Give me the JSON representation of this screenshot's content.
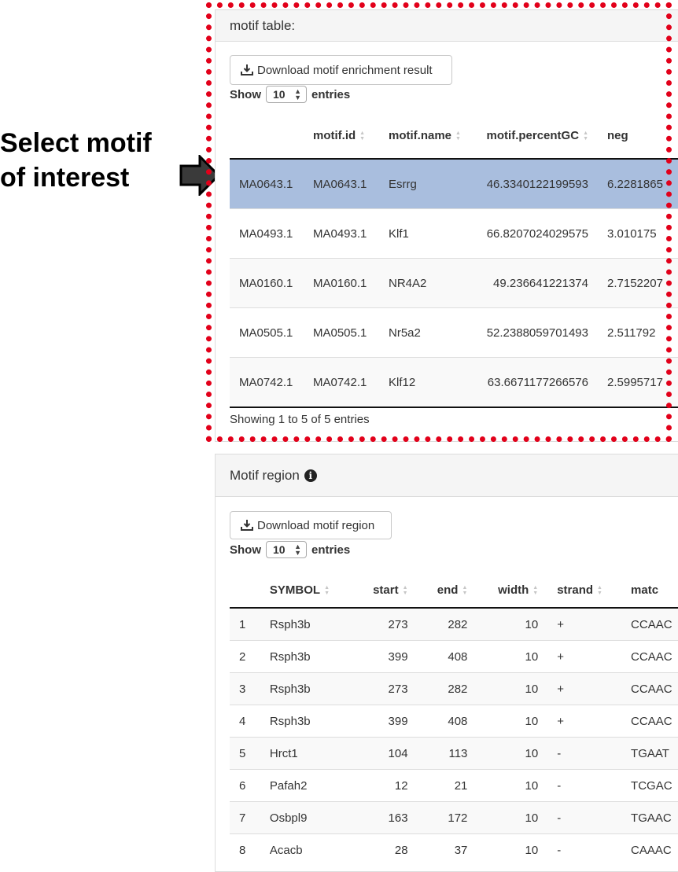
{
  "callout": {
    "line1": "Select motif",
    "line2": "of interest"
  },
  "motif_table": {
    "heading": "motif table:",
    "download_label": "Download motif enrichment result",
    "show_label": "Show",
    "page_length": "10",
    "entries_label": "entries",
    "columns": [
      "",
      "motif.id",
      "motif.name",
      "motif.percentGC",
      "neg"
    ],
    "rows": [
      [
        "MA0643.1",
        "MA0643.1",
        "Esrrg",
        "46.3340122199593",
        "6.2281865"
      ],
      [
        "MA0493.1",
        "MA0493.1",
        "Klf1",
        "66.8207024029575",
        "3.010175"
      ],
      [
        "MA0160.1",
        "MA0160.1",
        "NR4A2",
        "49.236641221374",
        "2.7152207"
      ],
      [
        "MA0505.1",
        "MA0505.1",
        "Nr5a2",
        "52.2388059701493",
        "2.511792"
      ],
      [
        "MA0742.1",
        "MA0742.1",
        "Klf12",
        "63.6671177266576",
        "2.5995717"
      ]
    ],
    "selected_row": 0,
    "footer": "Showing 1 to 5 of 5 entries"
  },
  "motif_region": {
    "heading": "Motif region",
    "info_icon": "i",
    "download_label": "Download motif region",
    "show_label": "Show",
    "page_length": "10",
    "entries_label": "entries",
    "columns": [
      "",
      "SYMBOL",
      "start",
      "end",
      "width",
      "strand",
      "matc"
    ],
    "rows": [
      [
        "1",
        "Rsph3b",
        "273",
        "282",
        "10",
        "+",
        "CCAAC"
      ],
      [
        "2",
        "Rsph3b",
        "399",
        "408",
        "10",
        "+",
        "CCAAC"
      ],
      [
        "3",
        "Rsph3b",
        "273",
        "282",
        "10",
        "+",
        "CCAAC"
      ],
      [
        "4",
        "Rsph3b",
        "399",
        "408",
        "10",
        "+",
        "CCAAC"
      ],
      [
        "5",
        "Hrct1",
        "104",
        "113",
        "10",
        "-",
        "TGAAT"
      ],
      [
        "6",
        "Pafah2",
        "12",
        "21",
        "10",
        "-",
        "TCGAC"
      ],
      [
        "7",
        "Osbpl9",
        "163",
        "172",
        "10",
        "-",
        "TGAAC"
      ],
      [
        "8",
        "Acacb",
        "28",
        "37",
        "10",
        "-",
        "CAAAC"
      ]
    ]
  },
  "colors": {
    "highlight_border": "#e2001a",
    "selected_row": "#a9bede"
  },
  "icons": [
    "download-icon",
    "info-icon",
    "arrow-right-icon",
    "sort-icon"
  ]
}
